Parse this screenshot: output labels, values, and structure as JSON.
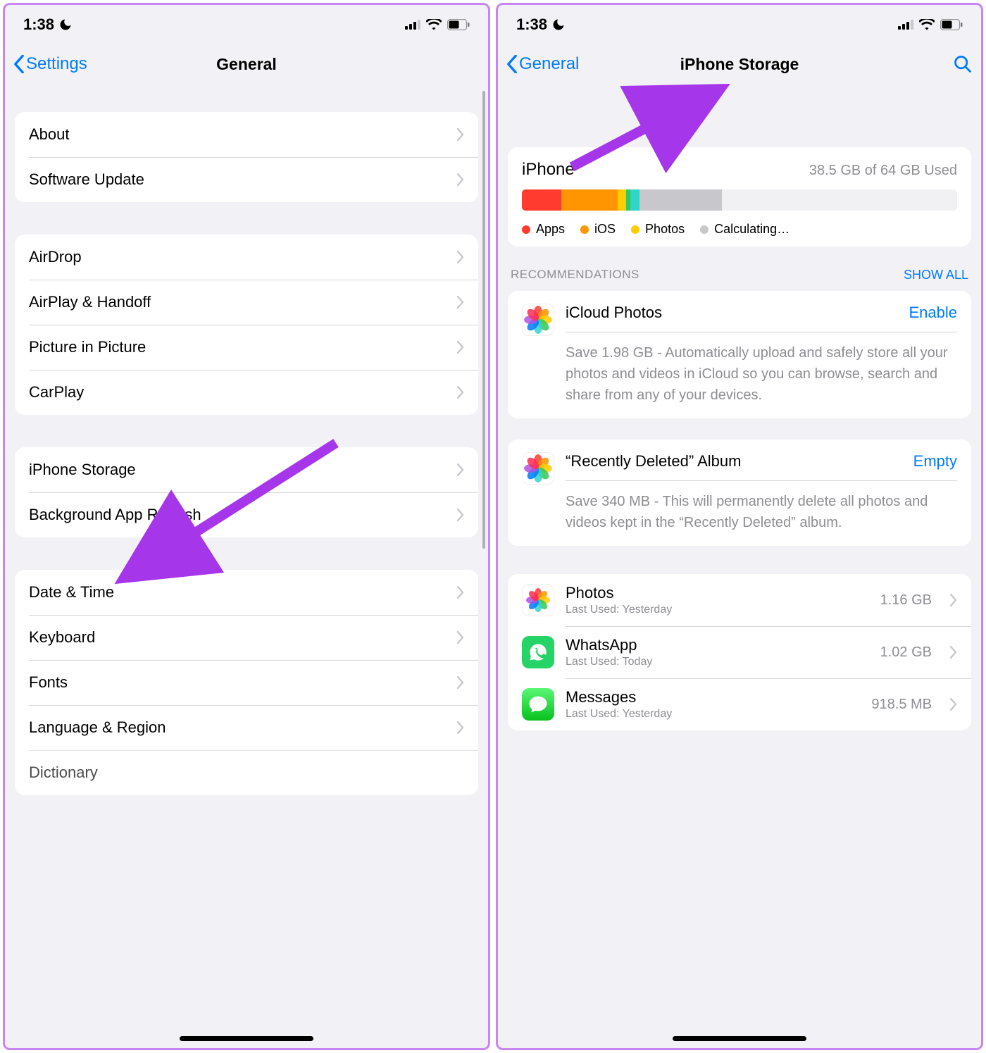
{
  "left": {
    "status": {
      "time": "1:38"
    },
    "nav": {
      "back_label": "Settings",
      "title": "General"
    },
    "group1": [
      {
        "id": "about",
        "label": "About"
      },
      {
        "id": "software-update",
        "label": "Software Update"
      }
    ],
    "group2": [
      {
        "id": "airdrop",
        "label": "AirDrop"
      },
      {
        "id": "airplay-handoff",
        "label": "AirPlay & Handoff"
      },
      {
        "id": "picture-in-picture",
        "label": "Picture in Picture"
      },
      {
        "id": "carplay",
        "label": "CarPlay"
      }
    ],
    "group3": [
      {
        "id": "iphone-storage",
        "label": "iPhone Storage"
      },
      {
        "id": "background-app-refresh",
        "label": "Background App Refresh"
      }
    ],
    "group4": [
      {
        "id": "date-time",
        "label": "Date & Time"
      },
      {
        "id": "keyboard",
        "label": "Keyboard"
      },
      {
        "id": "fonts",
        "label": "Fonts"
      },
      {
        "id": "language-region",
        "label": "Language & Region"
      },
      {
        "id": "dictionary",
        "label": "Dictionary"
      }
    ]
  },
  "right": {
    "status": {
      "time": "1:38"
    },
    "nav": {
      "back_label": "General",
      "title": "iPhone Storage"
    },
    "storage": {
      "device_label": "iPhone",
      "used_text": "38.5 GB of 64 GB Used",
      "segments": [
        {
          "id": "apps",
          "color": "#ff3b30",
          "pct": 9
        },
        {
          "id": "ios",
          "color": "#ff9500",
          "pct": 13
        },
        {
          "id": "photos",
          "color": "#ffcc00",
          "pct": 2
        },
        {
          "id": "other1",
          "color": "#34c759",
          "pct": 1
        },
        {
          "id": "other2",
          "color": "#30d5c8",
          "pct": 2
        },
        {
          "id": "buffer",
          "color": "#c7c7cc",
          "pct": 19
        }
      ],
      "legend": [
        {
          "label": "Apps",
          "color": "#ff3b30"
        },
        {
          "label": "iOS",
          "color": "#ff9500"
        },
        {
          "label": "Photos",
          "color": "#ffcc00"
        },
        {
          "label": "Calculating…",
          "color": "#c7c7cc"
        }
      ]
    },
    "recs": {
      "header": "RECOMMENDATIONS",
      "show_all": "SHOW ALL",
      "items": [
        {
          "id": "icloud-photos",
          "title": "iCloud Photos",
          "action": "Enable",
          "desc": "Save 1.98 GB - Automatically upload and safely store all your photos and videos in iCloud so you can browse, search and share from any of your devices."
        },
        {
          "id": "recently-deleted",
          "title": "“Recently Deleted” Album",
          "action": "Empty",
          "desc": "Save 340 MB - This will permanently delete all photos and videos kept in the “Recently Deleted” album."
        }
      ]
    },
    "apps": [
      {
        "id": "photos",
        "name": "Photos",
        "sub": "Last Used: Yesterday",
        "size": "1.16 GB",
        "bg": "#ffffff",
        "icon": "flower"
      },
      {
        "id": "whatsapp",
        "name": "WhatsApp",
        "sub": "Last Used: Today",
        "size": "1.02 GB",
        "bg": "#25d366",
        "icon": "phone"
      },
      {
        "id": "messages",
        "name": "Messages",
        "sub": "Last Used: Yesterday",
        "size": "918.5 MB",
        "bg": "#34c759",
        "icon": "bubble"
      }
    ]
  }
}
